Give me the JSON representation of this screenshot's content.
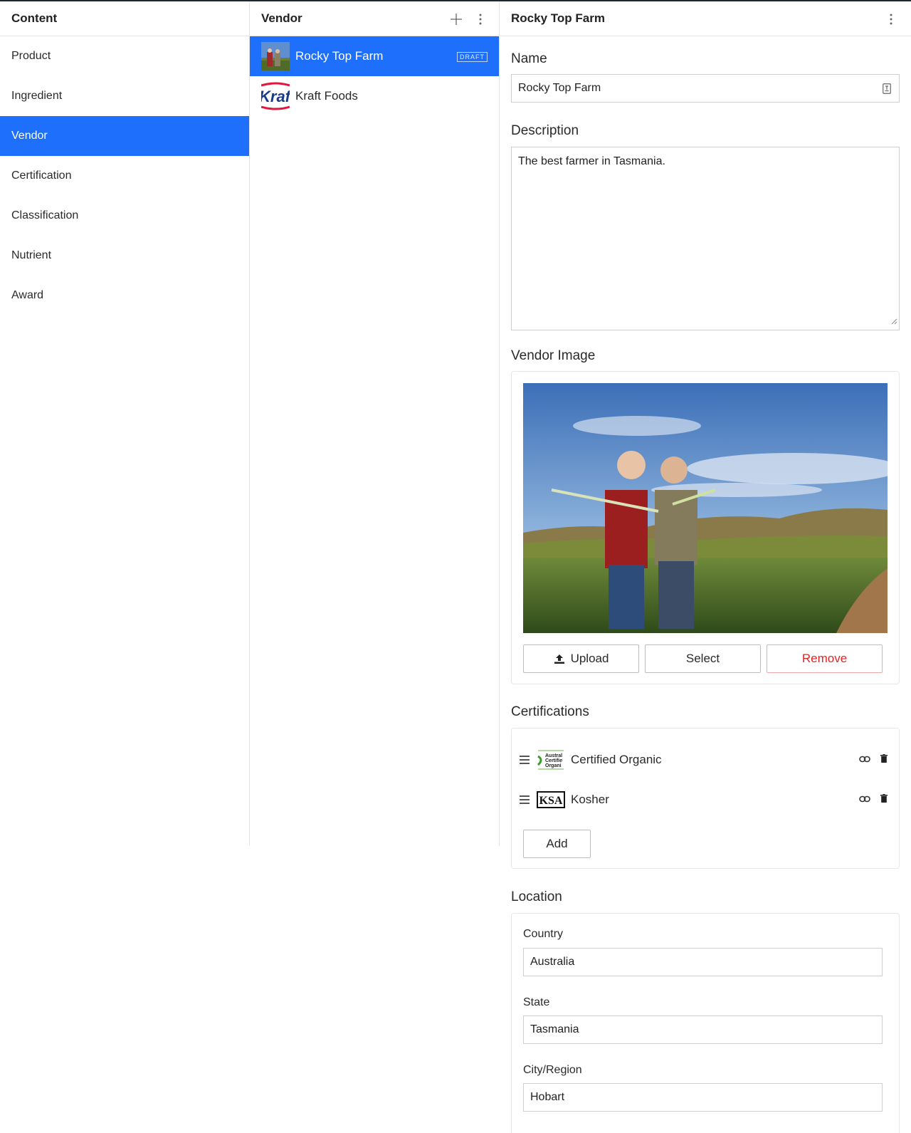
{
  "content_pane": {
    "title": "Content",
    "items": [
      {
        "label": "Product"
      },
      {
        "label": "Ingredient"
      },
      {
        "label": "Vendor"
      },
      {
        "label": "Certification"
      },
      {
        "label": "Classification"
      },
      {
        "label": "Nutrient"
      },
      {
        "label": "Award"
      }
    ],
    "active_index": 2
  },
  "vendor_pane": {
    "title": "Vendor",
    "add_icon": "plus-icon",
    "menu_icon": "kebab-icon",
    "items": [
      {
        "name": "Rocky Top Farm",
        "badge": "DRAFT",
        "thumb": "farm-photo"
      },
      {
        "name": "Kraft Foods",
        "thumb": "kraft-logo"
      }
    ]
  },
  "document": {
    "title": "Rocky Top Farm",
    "menu_icon": "kebab-icon",
    "name_label": "Name",
    "name_value": "Rocky Top Farm",
    "description_label": "Description",
    "description_value": "The best farmer in Tasmania.",
    "image_label": "Vendor Image",
    "image_buttons": {
      "upload": "Upload",
      "select": "Select",
      "remove": "Remove"
    },
    "certifications_label": "Certifications",
    "certifications": [
      {
        "name": "Certified Organic",
        "logo_text": [
          "Austral",
          "Certifie",
          "Organi"
        ]
      },
      {
        "name": "Kosher",
        "logo_text": "KSA"
      }
    ],
    "add_label": "Add",
    "location_label": "Location",
    "location": {
      "country_label": "Country",
      "country_value": "Australia",
      "state_label": "State",
      "state_value": "Tasmania",
      "city_label": "City/Region",
      "city_value": "Hobart"
    }
  },
  "colors": {
    "accent": "#1e6ffc",
    "danger": "#e02424",
    "border": "#cfcfcf"
  }
}
